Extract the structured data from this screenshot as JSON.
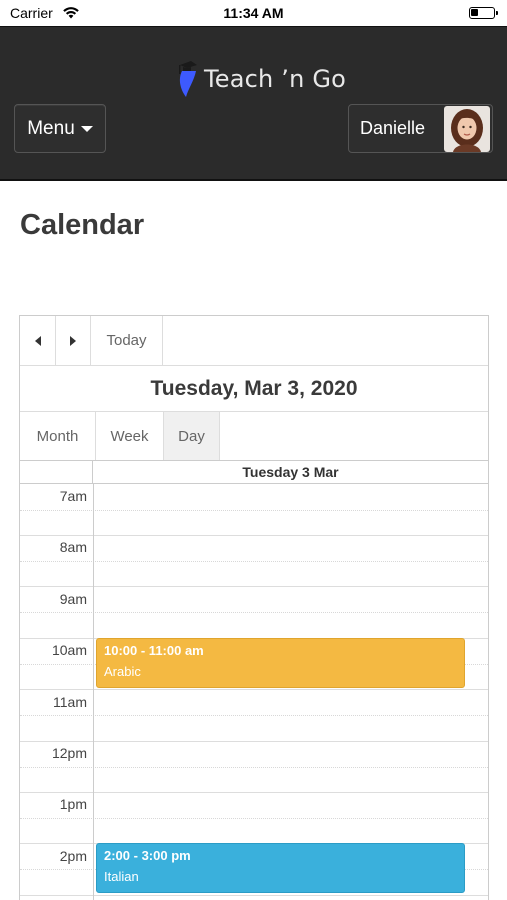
{
  "status_bar": {
    "carrier": "Carrier",
    "time": "11:34 AM"
  },
  "header": {
    "app_name": "Teach ’n Go",
    "menu_label": "Menu",
    "user_name": "Danielle"
  },
  "page": {
    "title": "Calendar"
  },
  "calendar": {
    "today_label": "Today",
    "current_date": "Tuesday, Mar 3, 2020",
    "views": {
      "month": "Month",
      "week": "Week",
      "day": "Day"
    },
    "active_view": "Day",
    "day_header": "Tuesday 3 Mar",
    "hours": [
      "7am",
      "8am",
      "9am",
      "10am",
      "11am",
      "12pm",
      "1pm",
      "2pm"
    ],
    "events": [
      {
        "time": "10:00 - 11:00 am",
        "title": "Arabic",
        "color": "#f4b942"
      },
      {
        "time": "2:00 - 3:00 pm",
        "title": "Italian",
        "color": "#3ab0dc"
      }
    ]
  },
  "colors": {
    "header_bg": "#2b2b2b",
    "logo_accent": "#3d5afe"
  }
}
